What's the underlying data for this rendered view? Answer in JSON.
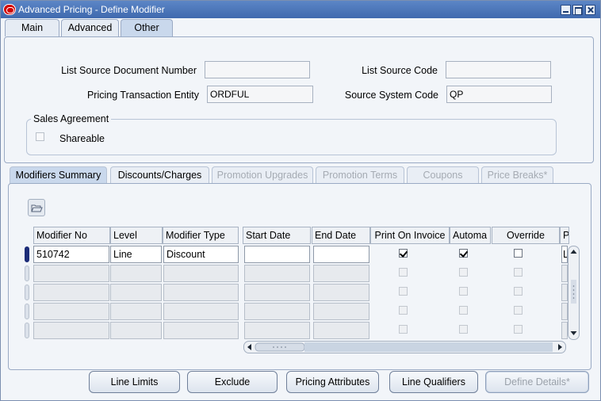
{
  "window": {
    "title": "Advanced Pricing - Define Modifier"
  },
  "top_tabs": [
    {
      "label": "Main"
    },
    {
      "label": "Advanced"
    },
    {
      "label": "Other"
    }
  ],
  "fields": {
    "list_source_document_number": {
      "label": "List Source Document Number",
      "value": ""
    },
    "list_source_code": {
      "label": "List Source Code",
      "value": ""
    },
    "pricing_transaction_entity": {
      "label": "Pricing Transaction Entity",
      "value": "ORDFUL"
    },
    "source_system_code": {
      "label": "Source System Code",
      "value": "QP"
    }
  },
  "sales_agreement": {
    "title": "Sales Agreement",
    "shareable_label": "Shareable"
  },
  "bottom_tabs": [
    {
      "label": "Modifiers Summary"
    },
    {
      "label": "Discounts/Charges"
    },
    {
      "label": "Promotion Upgrades"
    },
    {
      "label": "Promotion Terms"
    },
    {
      "label": "Coupons"
    },
    {
      "label": "Price Breaks*"
    }
  ],
  "table": {
    "columns": [
      "Modifier No",
      "Level",
      "Modifier Type",
      "Start Date",
      "End Date",
      "Print On Invoice",
      "Automa",
      "Override",
      "P"
    ],
    "rows": [
      {
        "modifier_no": "510742",
        "level": "Line",
        "modifier_type": "Discount",
        "start_date": "",
        "end_date": "",
        "print_on_invoice": true,
        "automatic": true,
        "override": false,
        "p": "L"
      }
    ]
  },
  "buttons": {
    "line_limits": "Line Limits",
    "exclude": "Exclude",
    "pricing_attributes": "Pricing Attributes",
    "line_qualifiers": "Line Qualifiers",
    "define_details": "Define Details*"
  },
  "colors": {
    "titlebar": "#4a74b8",
    "active_tab": "#c9d8ec",
    "row_indicator": "#1c2c78"
  },
  "icons": [
    "oracle-icon",
    "minimize-icon",
    "maximize-icon",
    "close-icon",
    "folder-icon",
    "scroll-up-icon",
    "scroll-down-icon",
    "scroll-left-icon",
    "scroll-right-icon"
  ]
}
